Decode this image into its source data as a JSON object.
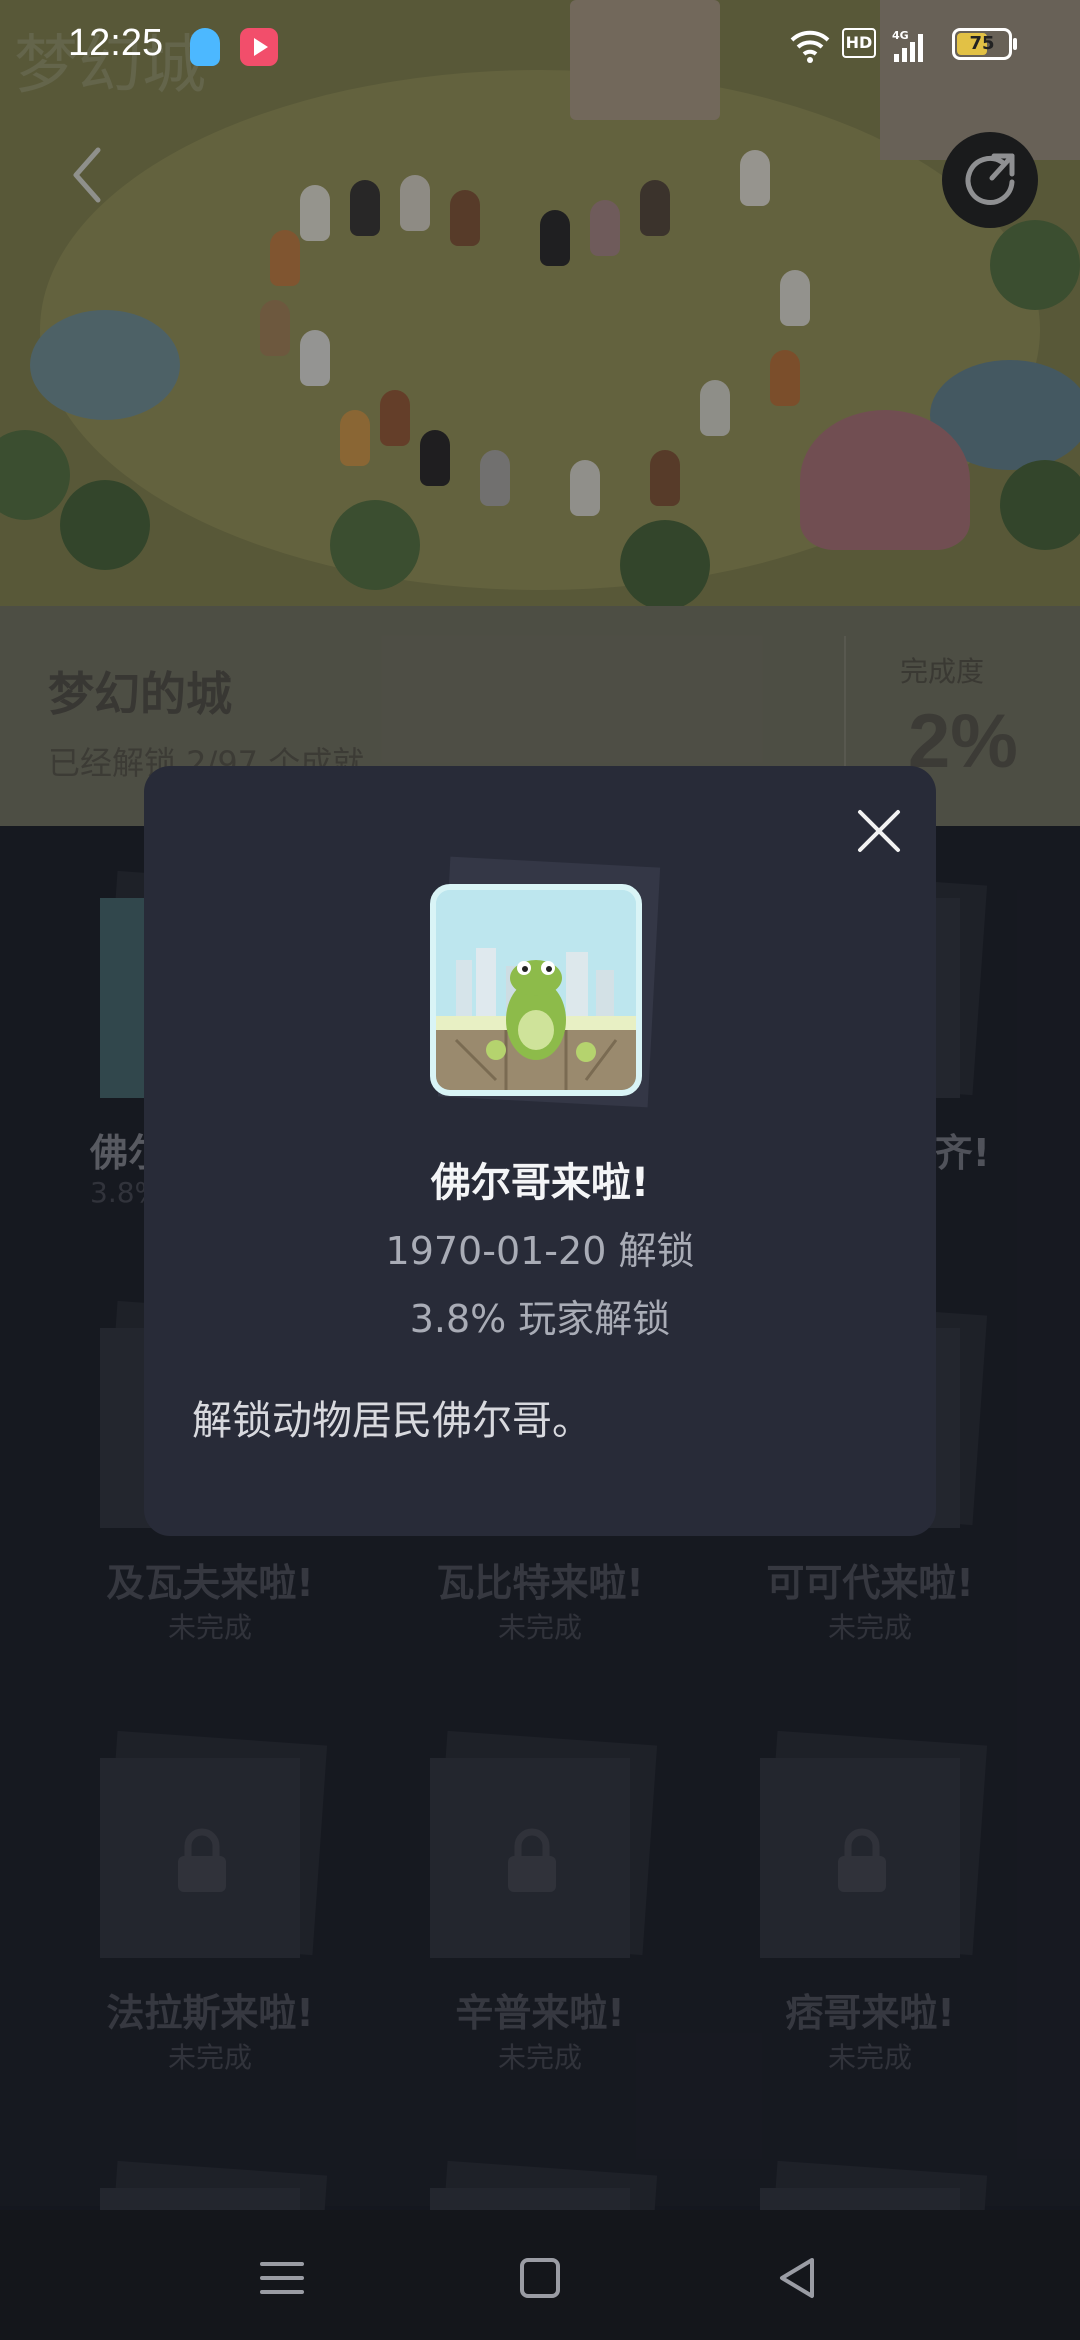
{
  "status_bar": {
    "time": "12:25",
    "battery": "75",
    "hd": "HD",
    "network": "4G"
  },
  "header": {
    "watermark": "梦幻城"
  },
  "map_info": {
    "title": "梦幻的城",
    "subtitle": "已经解锁 2/97 个成就",
    "progress_label": "完成度",
    "progress_value": "2%"
  },
  "achievements": [
    {
      "name": "佛尔哥来啦!",
      "stat": "3.8%",
      "locked": false
    },
    {
      "name": "",
      "stat": "",
      "locked": true
    },
    {
      "name": "齐!",
      "stat": "",
      "locked": false
    },
    {
      "name": "及瓦夫来啦!",
      "stat": "未完成",
      "locked": true
    },
    {
      "name": "瓦比特来啦!",
      "stat": "未完成",
      "locked": true
    },
    {
      "name": "可可代来啦!",
      "stat": "未完成",
      "locked": true
    },
    {
      "name": "法拉斯来啦!",
      "stat": "未完成",
      "locked": true
    },
    {
      "name": "辛普来啦!",
      "stat": "未完成",
      "locked": true
    },
    {
      "name": "痞哥来啦!",
      "stat": "未完成",
      "locked": true
    }
  ],
  "modal": {
    "title": "佛尔哥来啦!",
    "unlock_date": "1970-01-20 解锁",
    "player_pct": "3.8% 玩家解锁",
    "description": "解锁动物居民佛尔哥。"
  },
  "colors": {
    "modal_bg": "#282b38",
    "accent": "#bfe7ef"
  }
}
